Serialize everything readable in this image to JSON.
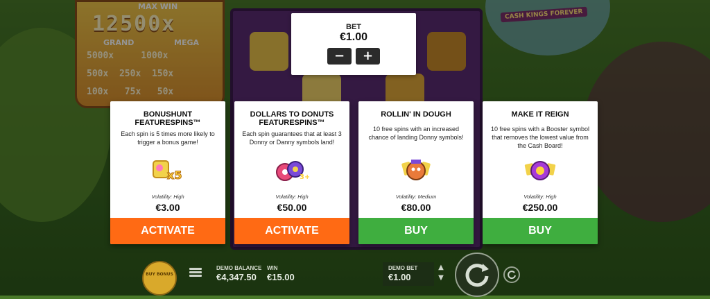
{
  "jackpot": {
    "header": "MAX WIN",
    "top_value": "12500x",
    "grand_label": "GRAND",
    "mega_label": "MEGA",
    "rows": [
      [
        "5000x",
        "1000x"
      ],
      [
        "500x",
        "250x",
        "150x"
      ],
      [
        "100x",
        "75x",
        "50x"
      ]
    ]
  },
  "logo": {
    "subtitle": "CASH KINGS FOREVER"
  },
  "bet_panel": {
    "label": "BET",
    "value": "€1.00",
    "minus": "−",
    "plus": "+"
  },
  "cards": [
    {
      "title": "BONUSHUNT FEATURESPINS™",
      "description": "Each spin is 5 times more likely to trigger a bonus game!",
      "volatility": "Volatility: High",
      "price": "€3.00",
      "button": "ACTIVATE",
      "icon": "bonushunt-icon",
      "button_color": "#ff6a14"
    },
    {
      "title": "DOLLARS TO DONUTS FEATURESPINS™",
      "description": "Each spin guarantees that at least 3 Donny or Danny symbols land!",
      "volatility": "Volatility: High",
      "price": "€50.00",
      "button": "ACTIVATE",
      "icon": "donuts-icon",
      "button_color": "#ff6a14"
    },
    {
      "title": "ROLLIN' IN DOUGH",
      "description": "10 free spins with an increased chance of landing Donny symbols!",
      "volatility": "Volatility: Medium",
      "price": "€80.00",
      "button": "BUY",
      "icon": "dough-icon",
      "button_color": "#3fae3f"
    },
    {
      "title": "MAKE IT REIGN",
      "description": "10 free spins with a Booster symbol that removes the lowest value from the Cash Board!",
      "volatility": "Volatility: High",
      "price": "€250.00",
      "button": "BUY",
      "icon": "reign-icon",
      "button_color": "#3fae3f"
    }
  ],
  "bottom_bar": {
    "buy_bonus": "BUY BONUS",
    "demo_balance_label": "DEMO BALANCE",
    "demo_balance_value": "€4,347.50",
    "win_label": "WIN",
    "win_value": "€15.00",
    "demo_bet_label": "DEMO BET",
    "demo_bet_value": "€1.00"
  }
}
